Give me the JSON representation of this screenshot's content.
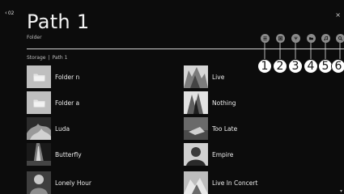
{
  "header": {
    "back_label": "02",
    "title": "Path 1",
    "subtitle": "Folder",
    "close_label": "×"
  },
  "breadcrumb": {
    "root": "Storage",
    "separator": "|",
    "current": "Path 1"
  },
  "toolbar": {
    "buttons": [
      {
        "icon": "list-view-icon"
      },
      {
        "icon": "content-filter-icon"
      },
      {
        "icon": "sort-icon"
      },
      {
        "icon": "folder-icon"
      },
      {
        "icon": "music-note-icon"
      },
      {
        "icon": "search-icon"
      }
    ],
    "callouts": [
      "1",
      "2",
      "3",
      "4",
      "5",
      "6"
    ]
  },
  "items": {
    "left": [
      {
        "label": "Folder n",
        "kind": "folder"
      },
      {
        "label": "Folder a",
        "kind": "folder"
      },
      {
        "label": "Luda",
        "kind": "photo"
      },
      {
        "label": "Butterfly",
        "kind": "photo"
      },
      {
        "label": "Lonely Hour",
        "kind": "photo"
      }
    ],
    "right": [
      {
        "label": "Live",
        "kind": "photo"
      },
      {
        "label": "Nothing",
        "kind": "photo"
      },
      {
        "label": "Too Late",
        "kind": "photo"
      },
      {
        "label": "Empire",
        "kind": "photo"
      },
      {
        "label": "Live In Concert",
        "kind": "photo"
      }
    ]
  },
  "colors": {
    "background": "#0c0c0c",
    "toolbar_button": "#8a8a8a",
    "folder_thumb": "#bfbfbf",
    "divider": "#cfcfcf"
  }
}
